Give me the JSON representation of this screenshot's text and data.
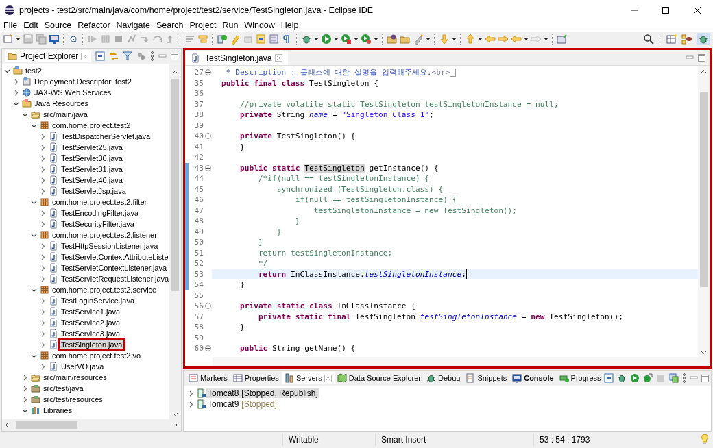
{
  "window": {
    "title": "projects - test2/src/main/java/com/home/project/test2/service/TestSingleton.java - Eclipse IDE"
  },
  "menu": [
    "File",
    "Edit",
    "Source",
    "Refactor",
    "Navigate",
    "Search",
    "Project",
    "Run",
    "Window",
    "Help"
  ],
  "explorer": {
    "title": "Project Explorer",
    "tree": [
      {
        "label": "test2",
        "kind": "project",
        "expanded": true,
        "selected": false,
        "annotated": false,
        "children": [
          {
            "label": "Deployment Descriptor: test2",
            "kind": "descriptor",
            "expanded": false,
            "selected": false,
            "annotated": false
          },
          {
            "label": "JAX-WS Web Services",
            "kind": "webservice",
            "expanded": false,
            "selected": false,
            "annotated": false
          },
          {
            "label": "Java Resources",
            "kind": "resources",
            "expanded": true,
            "selected": false,
            "annotated": false,
            "children": [
              {
                "label": "src/main/java",
                "kind": "srcfolder",
                "expanded": true,
                "selected": false,
                "annotated": false,
                "children": [
                  {
                    "label": "com.home.project.test2",
                    "kind": "package",
                    "expanded": true,
                    "selected": false,
                    "annotated": false,
                    "children": [
                      {
                        "label": "TestDispatcherServlet.java",
                        "kind": "java",
                        "expanded": false,
                        "selected": false,
                        "annotated": false
                      },
                      {
                        "label": "TestServlet25.java",
                        "kind": "java",
                        "expanded": false,
                        "selected": false,
                        "annotated": false
                      },
                      {
                        "label": "TestServlet30.java",
                        "kind": "java",
                        "expanded": false,
                        "selected": false,
                        "annotated": false
                      },
                      {
                        "label": "TestServlet31.java",
                        "kind": "java",
                        "expanded": false,
                        "selected": false,
                        "annotated": false
                      },
                      {
                        "label": "TestServlet40.java",
                        "kind": "java",
                        "expanded": false,
                        "selected": false,
                        "annotated": false
                      },
                      {
                        "label": "TestServletJsp.java",
                        "kind": "java",
                        "expanded": false,
                        "selected": false,
                        "annotated": false
                      }
                    ]
                  },
                  {
                    "label": "com.home.project.test2.filter",
                    "kind": "package",
                    "expanded": true,
                    "selected": false,
                    "annotated": false,
                    "children": [
                      {
                        "label": "TestEncodingFilter.java",
                        "kind": "java",
                        "expanded": false,
                        "selected": false,
                        "annotated": false
                      },
                      {
                        "label": "TestSecurityFilter.java",
                        "kind": "java",
                        "expanded": false,
                        "selected": false,
                        "annotated": false
                      }
                    ]
                  },
                  {
                    "label": "com.home.project.test2.listener",
                    "kind": "package",
                    "expanded": true,
                    "selected": false,
                    "annotated": false,
                    "children": [
                      {
                        "label": "TestHttpSessionListener.java",
                        "kind": "java",
                        "expanded": false,
                        "selected": false,
                        "annotated": false
                      },
                      {
                        "label": "TestServletContextAttributeListe",
                        "kind": "java",
                        "expanded": false,
                        "selected": false,
                        "annotated": false
                      },
                      {
                        "label": "TestServletContextListener.java",
                        "kind": "java",
                        "expanded": false,
                        "selected": false,
                        "annotated": false
                      },
                      {
                        "label": "TestServletRequestListener.java",
                        "kind": "java",
                        "expanded": false,
                        "selected": false,
                        "annotated": false
                      }
                    ]
                  },
                  {
                    "label": "com.home.project.test2.service",
                    "kind": "package",
                    "expanded": true,
                    "selected": false,
                    "annotated": false,
                    "children": [
                      {
                        "label": "TestLoginService.java",
                        "kind": "java",
                        "expanded": false,
                        "selected": false,
                        "annotated": false
                      },
                      {
                        "label": "TestService1.java",
                        "kind": "java",
                        "expanded": false,
                        "selected": false,
                        "annotated": false
                      },
                      {
                        "label": "TestService2.java",
                        "kind": "java",
                        "expanded": false,
                        "selected": false,
                        "annotated": false
                      },
                      {
                        "label": "TestService3.java",
                        "kind": "java",
                        "expanded": false,
                        "selected": false,
                        "annotated": false
                      },
                      {
                        "label": "TestSingleton.java",
                        "kind": "java",
                        "expanded": false,
                        "selected": true,
                        "annotated": true
                      }
                    ]
                  },
                  {
                    "label": "com.home.project.test2.vo",
                    "kind": "package",
                    "expanded": true,
                    "selected": false,
                    "annotated": false,
                    "children": [
                      {
                        "label": "UserVO.java",
                        "kind": "java",
                        "expanded": false,
                        "selected": false,
                        "annotated": false
                      }
                    ]
                  }
                ]
              },
              {
                "label": "src/main/resources",
                "kind": "srcfolder",
                "expanded": false,
                "selected": false,
                "annotated": false
              },
              {
                "label": "src/test/java",
                "kind": "testfolder",
                "expanded": false,
                "selected": false,
                "annotated": false
              },
              {
                "label": "src/test/resources",
                "kind": "testfolder",
                "expanded": false,
                "selected": false,
                "annotated": false
              },
              {
                "label": "Libraries",
                "kind": "library",
                "expanded": true,
                "selected": false,
                "annotated": false
              }
            ]
          }
        ]
      }
    ]
  },
  "editor": {
    "tab": "TestSingleton.java",
    "annotated": true,
    "lines": [
      {
        "num": "27",
        "folded": true,
        "changed": false,
        "current": false,
        "tokens": [
          {
            "kind": "doc",
            "text": " * Description : 클래스에 대한 설명을 입력해주세요."
          },
          {
            "kind": "tag",
            "text": "<br>"
          }
        ]
      },
      {
        "num": "35",
        "changed": false,
        "current": false,
        "tokens": [
          {
            "kind": "kw",
            "text": "public final class"
          },
          {
            "kind": "plain",
            "text": " TestSingleton {"
          }
        ]
      },
      {
        "num": "36",
        "changed": false,
        "current": false
      },
      {
        "num": "37",
        "changed": false,
        "current": false,
        "tokens": [
          {
            "kind": "cm",
            "text": "    //private volatile static TestSingleton testSingletonInstance = null;"
          }
        ]
      },
      {
        "num": "38",
        "changed": false,
        "current": false,
        "tokens": [
          {
            "kind": "kw",
            "text": "    private"
          },
          {
            "kind": "plain",
            "text": " String "
          },
          {
            "kind": "field",
            "text": "name"
          },
          {
            "kind": "plain",
            "text": " = "
          },
          {
            "kind": "str",
            "text": "\"Singleton Class 1\""
          },
          {
            "kind": "plain",
            "text": ";"
          }
        ]
      },
      {
        "num": "39",
        "changed": false,
        "current": false
      },
      {
        "num": "40",
        "folded": false,
        "changed": false,
        "current": false,
        "tokens": [
          {
            "kind": "kw",
            "text": "    private"
          },
          {
            "kind": "plain",
            "text": " TestSingleton() {"
          }
        ]
      },
      {
        "num": "41",
        "changed": false,
        "current": false,
        "tokens": [
          {
            "kind": "plain",
            "text": "    }"
          }
        ]
      },
      {
        "num": "42",
        "changed": false,
        "current": false
      },
      {
        "num": "43",
        "folded": false,
        "changed": true,
        "current": false,
        "tokens": [
          {
            "kind": "kw",
            "text": "    public static "
          },
          {
            "kind": "occurrence",
            "text": "TestSingleton"
          },
          {
            "kind": "plain",
            "text": " getInstance() {"
          }
        ]
      },
      {
        "num": "44",
        "changed": true,
        "current": false,
        "tokens": [
          {
            "kind": "cm",
            "text": "        /*if(null == testSingletonInstance) {"
          }
        ]
      },
      {
        "num": "45",
        "changed": true,
        "current": false,
        "tokens": [
          {
            "kind": "cm",
            "text": "            synchronized (TestSingleton.class) {"
          }
        ]
      },
      {
        "num": "46",
        "changed": true,
        "current": false,
        "tokens": [
          {
            "kind": "cm",
            "text": "                if(null == testSingletonInstance) {"
          }
        ]
      },
      {
        "num": "47",
        "changed": true,
        "current": false,
        "tokens": [
          {
            "kind": "cm",
            "text": "                    testSingletonInstance = new TestSingleton();"
          }
        ]
      },
      {
        "num": "48",
        "changed": true,
        "current": false,
        "tokens": [
          {
            "kind": "cm",
            "text": "                }"
          }
        ]
      },
      {
        "num": "49",
        "changed": true,
        "current": false,
        "tokens": [
          {
            "kind": "cm",
            "text": "            }"
          }
        ]
      },
      {
        "num": "50",
        "changed": true,
        "current": false,
        "tokens": [
          {
            "kind": "cm",
            "text": "        }"
          }
        ]
      },
      {
        "num": "51",
        "changed": true,
        "current": false,
        "tokens": [
          {
            "kind": "cm",
            "text": "        return testSingletonInstance;"
          }
        ]
      },
      {
        "num": "52",
        "changed": true,
        "current": false,
        "tokens": [
          {
            "kind": "cm",
            "text": "        */"
          }
        ]
      },
      {
        "num": "53",
        "changed": true,
        "current": true,
        "tokens": [
          {
            "kind": "kw",
            "text": "        return"
          },
          {
            "kind": "plain",
            "text": " InClassInstance."
          },
          {
            "kind": "field",
            "text": "testSingletonInstance"
          },
          {
            "kind": "plain",
            "text": ";"
          }
        ]
      },
      {
        "num": "54",
        "changed": true,
        "current": false,
        "tokens": [
          {
            "kind": "plain",
            "text": "    }"
          }
        ]
      },
      {
        "num": "55",
        "changed": false,
        "current": false
      },
      {
        "num": "56",
        "folded": false,
        "changed": false,
        "current": false,
        "tokens": [
          {
            "kind": "kw",
            "text": "    private static class"
          },
          {
            "kind": "plain",
            "text": " InClassInstance {"
          }
        ]
      },
      {
        "num": "57",
        "changed": false,
        "current": false,
        "tokens": [
          {
            "kind": "kw",
            "text": "        private static final"
          },
          {
            "kind": "plain",
            "text": " TestSingleton "
          },
          {
            "kind": "field",
            "text": "testSingletonInstance"
          },
          {
            "kind": "plain",
            "text": " = "
          },
          {
            "kind": "kw",
            "text": "new"
          },
          {
            "kind": "plain",
            "text": " TestSingleton();"
          }
        ]
      },
      {
        "num": "58",
        "changed": false,
        "current": false,
        "tokens": [
          {
            "kind": "plain",
            "text": "    }"
          }
        ]
      },
      {
        "num": "59",
        "changed": false,
        "current": false
      },
      {
        "num": "60",
        "folded": false,
        "changed": false,
        "current": false,
        "tokens": [
          {
            "kind": "kw",
            "text": "    public"
          },
          {
            "kind": "plain",
            "text": " String getName() {"
          }
        ]
      }
    ]
  },
  "bottom_panel": {
    "tabs": [
      {
        "label": "Markers",
        "kind": "markers",
        "selected": false,
        "bold": false
      },
      {
        "label": "Properties",
        "kind": "properties",
        "selected": false,
        "bold": false
      },
      {
        "label": "Servers",
        "kind": "servers",
        "selected": true,
        "bold": false
      },
      {
        "label": "Data Source Explorer",
        "kind": "datasource",
        "selected": false,
        "bold": false
      },
      {
        "label": "Debug",
        "kind": "debug",
        "selected": false,
        "bold": false
      },
      {
        "label": "Snippets",
        "kind": "snippets",
        "selected": false,
        "bold": false
      },
      {
        "label": "Console",
        "kind": "console",
        "selected": false,
        "bold": true
      },
      {
        "label": "Progress",
        "kind": "progress",
        "selected": false,
        "bold": false
      }
    ],
    "servers": [
      {
        "name": "Tomcat8",
        "status": "[Stopped, Republish]",
        "selected": true
      },
      {
        "name": "Tomcat9",
        "status": "[Stopped]",
        "selected": false
      }
    ]
  },
  "status_bar": [
    "Writable",
    "Smart Insert",
    "53 : 54 : 1793"
  ]
}
